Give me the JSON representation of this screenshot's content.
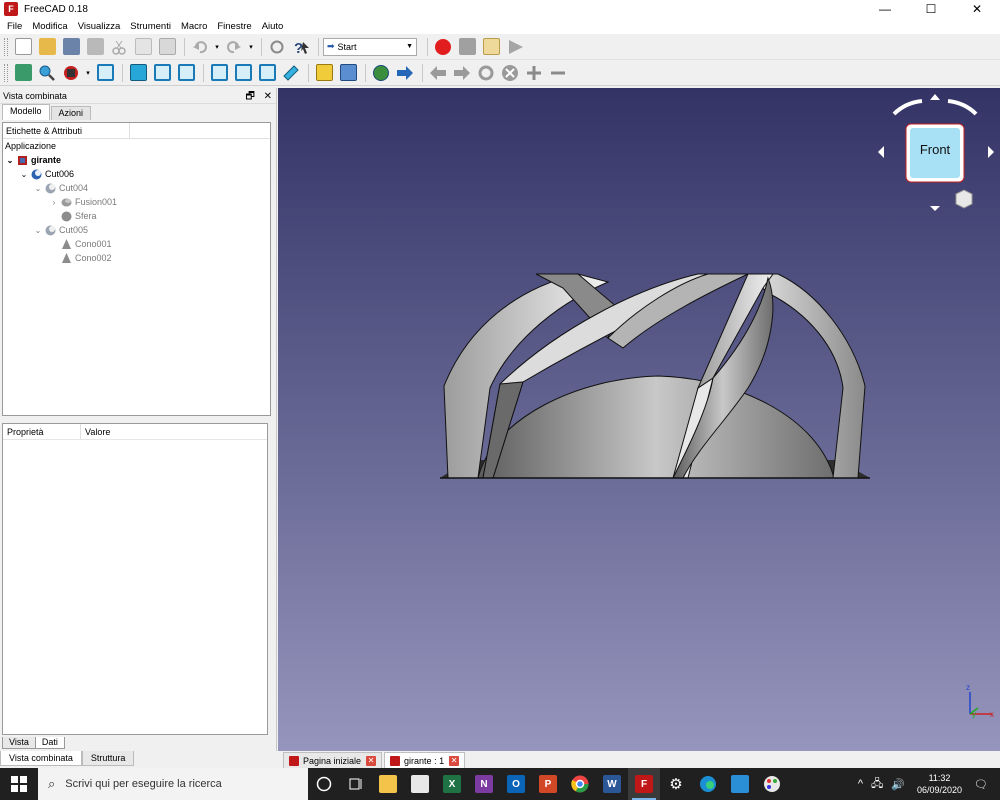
{
  "window": {
    "title": "FreeCAD 0.18",
    "minimize": "—",
    "maximize": "☐",
    "close": "✕"
  },
  "menu": [
    "File",
    "Modifica",
    "Visualizza",
    "Strumenti",
    "Macro",
    "Finestre",
    "Aiuto"
  ],
  "toolbar": {
    "workbench": "Start"
  },
  "panel": {
    "title": "Vista combinata",
    "tabs": [
      "Modello",
      "Azioni"
    ],
    "tree_header": "Etichette & Attributi",
    "tree_root": "Applicazione",
    "tree": [
      {
        "label": "girante",
        "twisty": "⌄"
      },
      {
        "label": "Cut006",
        "twisty": "⌄"
      },
      {
        "label": "Cut004",
        "twisty": "⌄"
      },
      {
        "label": "Fusion001",
        "twisty": "›"
      },
      {
        "label": "Sfera",
        "twisty": ""
      },
      {
        "label": "Cut005",
        "twisty": "⌄"
      },
      {
        "label": "Cono001",
        "twisty": ""
      },
      {
        "label": "Cono002",
        "twisty": ""
      }
    ],
    "prop_headers": [
      "Proprietà",
      "Valore"
    ],
    "sub_tabs": [
      "Vista",
      "Dati"
    ],
    "panel_tabs": [
      "Vista combinata",
      "Struttura"
    ]
  },
  "viewport": {
    "navicube_face": "Front",
    "axis_x": "x",
    "axis_y": "y",
    "axis_z": "z"
  },
  "doc_tabs": [
    "Pagina iniziale",
    "girante : 1"
  ],
  "taskbar": {
    "search_placeholder": "Scrivi qui per eseguire la ricerca",
    "time": "11:32",
    "date": "06/09/2020"
  },
  "colors": {
    "viewport_top": "#333366",
    "viewport_bottom": "#9595bd",
    "record": "#e11d1d",
    "navicube_face": "#a8e0f5"
  }
}
